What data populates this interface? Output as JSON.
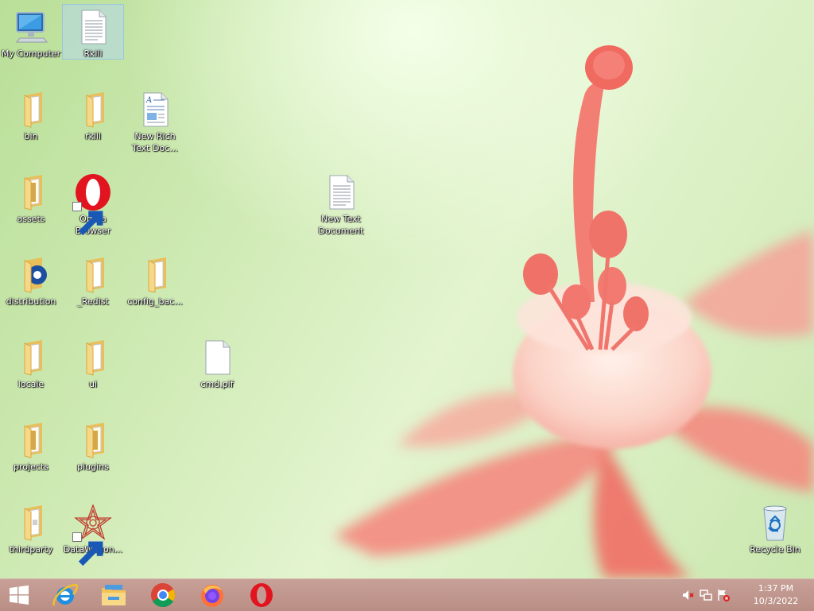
{
  "desktop": {
    "icons": [
      {
        "label": "My Computer",
        "icon": "computer-icon"
      },
      {
        "label": "Rkill",
        "icon": "text-file-icon",
        "selected": true
      },
      {
        "label": "bin",
        "icon": "folder-icon"
      },
      {
        "label": "rkill",
        "icon": "folder-icon"
      },
      {
        "label": "New Rich Text Doc...",
        "icon": "rich-text-document-icon"
      },
      {
        "label": "assets",
        "icon": "folder-icon"
      },
      {
        "label": "Opera Browser",
        "icon": "opera-icon",
        "shortcut": true
      },
      {
        "label": "New Text Document",
        "icon": "text-file-icon"
      },
      {
        "label": "distribution",
        "icon": "folder-icon"
      },
      {
        "label": "_Redist",
        "icon": "folder-icon"
      },
      {
        "label": "config_bac...",
        "icon": "folder-icon"
      },
      {
        "label": "locale",
        "icon": "folder-icon"
      },
      {
        "label": "ui",
        "icon": "folder-icon"
      },
      {
        "label": "cmd.pif",
        "icon": "blank-file-icon"
      },
      {
        "label": "projects",
        "icon": "folder-icon"
      },
      {
        "label": "plugins",
        "icon": "folder-icon"
      },
      {
        "label": "thirdparty",
        "icon": "folder-icon"
      },
      {
        "label": "DataWagon...",
        "icon": "datawagon-icon",
        "shortcut": true
      },
      {
        "label": "Recycle Bin",
        "icon": "recycle-bin-icon"
      }
    ]
  },
  "taskbar": {
    "pinned": [
      {
        "name": "start-button",
        "icon": "windows-logo-icon"
      },
      {
        "name": "internet-explorer",
        "icon": "internet-explorer-icon"
      },
      {
        "name": "file-explorer",
        "icon": "file-explorer-icon"
      },
      {
        "name": "chrome",
        "icon": "chrome-icon"
      },
      {
        "name": "firefox",
        "icon": "firefox-icon"
      },
      {
        "name": "opera",
        "icon": "opera-icon"
      }
    ],
    "tray": {
      "icons": [
        "volume-muted-icon",
        "network-icon",
        "action-center-flag-icon"
      ],
      "time": "1:37 PM",
      "date": "10/3/2022"
    }
  },
  "colors": {
    "taskbar": "#c19990",
    "folder": "#f2d27a",
    "flower": "#f0827a"
  }
}
